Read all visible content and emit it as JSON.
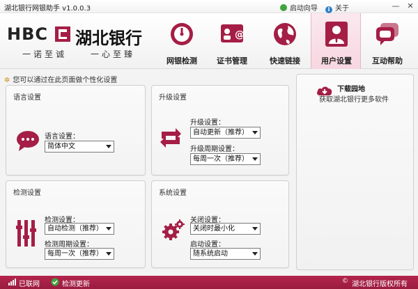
{
  "titlebar": {
    "app_title": "湖北银行网银助手 v1.0.0.3",
    "guide": "启动向导",
    "about": "关于",
    "minimize": "—",
    "close": "✕"
  },
  "logo": {
    "hbc": "HBC",
    "bank_name": "湖北银行",
    "slogan_left": "一诺至诚",
    "slogan_right": "一心至臻"
  },
  "nav": {
    "tabs": [
      {
        "label": "网银检测",
        "icon": "gauge-icon"
      },
      {
        "label": "证书管理",
        "icon": "certificate-icon"
      },
      {
        "label": "快速链接",
        "icon": "globe-icon"
      },
      {
        "label": "用户设置",
        "icon": "user-icon",
        "active": true
      },
      {
        "label": "互动帮助",
        "icon": "chat-icon"
      }
    ]
  },
  "hint": "您可以通过在此页面做个性化设置",
  "panels": {
    "language": {
      "title": "语言设置",
      "field_label": "语言设置：",
      "value": "简体中文"
    },
    "upgrade": {
      "title": "升级设置",
      "field1_label": "升级设置：",
      "field1_value": "自动更新（推荐）",
      "field2_label": "升级周期设置：",
      "field2_value": "每周一次（推荐）"
    },
    "detect": {
      "title": "检测设置",
      "field1_label": "检测设置：",
      "field1_value": "自动检测（推荐）",
      "field2_label": "检测周期设置：",
      "field2_value": "每周一次（推荐）"
    },
    "system": {
      "title": "系统设置",
      "field1_label": "关闭设置：",
      "field1_value": "关闭时最小化",
      "field2_label": "启动设置：",
      "field2_value": "随系统启动"
    }
  },
  "download": {
    "title": "下载园地",
    "desc": "获取湖北银行更多软件"
  },
  "statusbar": {
    "connected": "已联网",
    "update": "检测更新",
    "copyright": "湖北银行版权所有"
  },
  "colors": {
    "brand": "#a51e45",
    "status_green": "#3da53d"
  }
}
